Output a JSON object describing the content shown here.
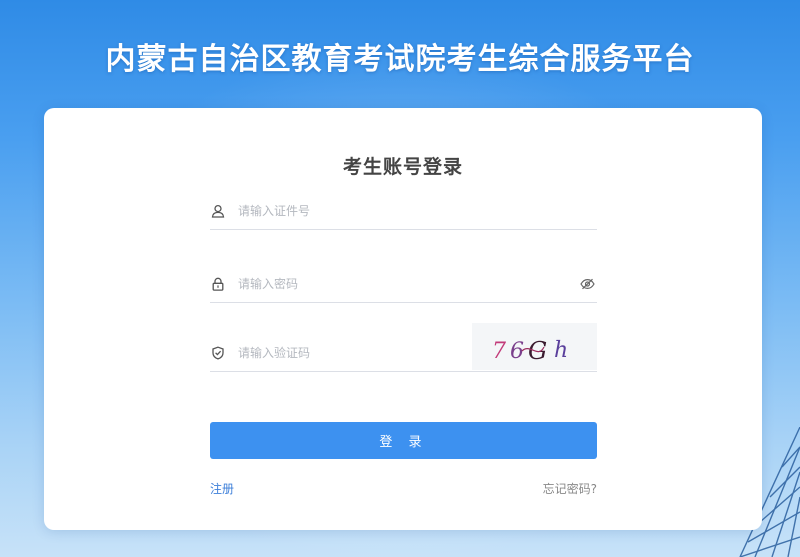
{
  "header": {
    "title": "内蒙古自治区教育考试院考生综合服务平台"
  },
  "login_form": {
    "title": "考生账号登录",
    "id_number": {
      "placeholder": "请输入证件号",
      "value": ""
    },
    "password": {
      "placeholder": "请输入密码",
      "value": ""
    },
    "captcha": {
      "placeholder": "请输入验证码",
      "value": "",
      "image_text": "76Gh"
    },
    "submit_label": "登 录",
    "register_link": "注册",
    "forgot_link": "忘记密码?"
  },
  "colors": {
    "primary": "#3d91f0",
    "link": "#3d7fd9",
    "title_text": "#444444",
    "background_top": "#2f8be6"
  },
  "icons": [
    "user-icon",
    "lock-icon",
    "eye-slash-icon",
    "shield-check-icon"
  ]
}
